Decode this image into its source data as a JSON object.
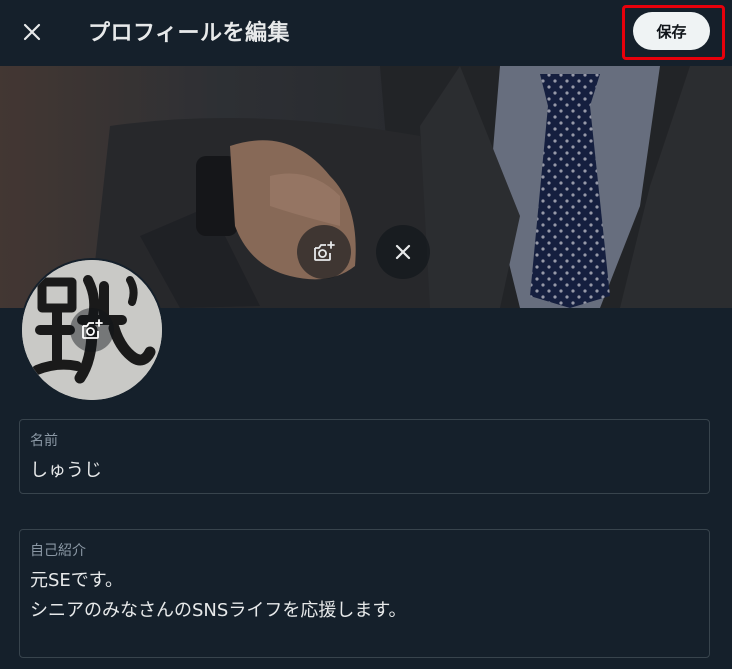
{
  "header": {
    "close_icon": "close-icon",
    "title": "プロフィールを編集",
    "save_label": "保存",
    "highlight_color": "#e8000b"
  },
  "banner": {
    "camera_icon": "camera-add-icon",
    "remove_icon": "close-icon"
  },
  "avatar": {
    "camera_icon": "camera-add-icon",
    "glyph": "蹴"
  },
  "fields": {
    "name": {
      "label": "名前",
      "value": "しゅうじ"
    },
    "bio": {
      "label": "自己紹介",
      "lines": [
        "元SEです。",
        "シニアのみなさんのSNSライフを応援します。"
      ]
    }
  },
  "colors": {
    "background": "#15202b",
    "border": "#38444d",
    "label": "#8b98a5",
    "text": "#e7e9ea",
    "save_bg": "#eff3f4"
  }
}
